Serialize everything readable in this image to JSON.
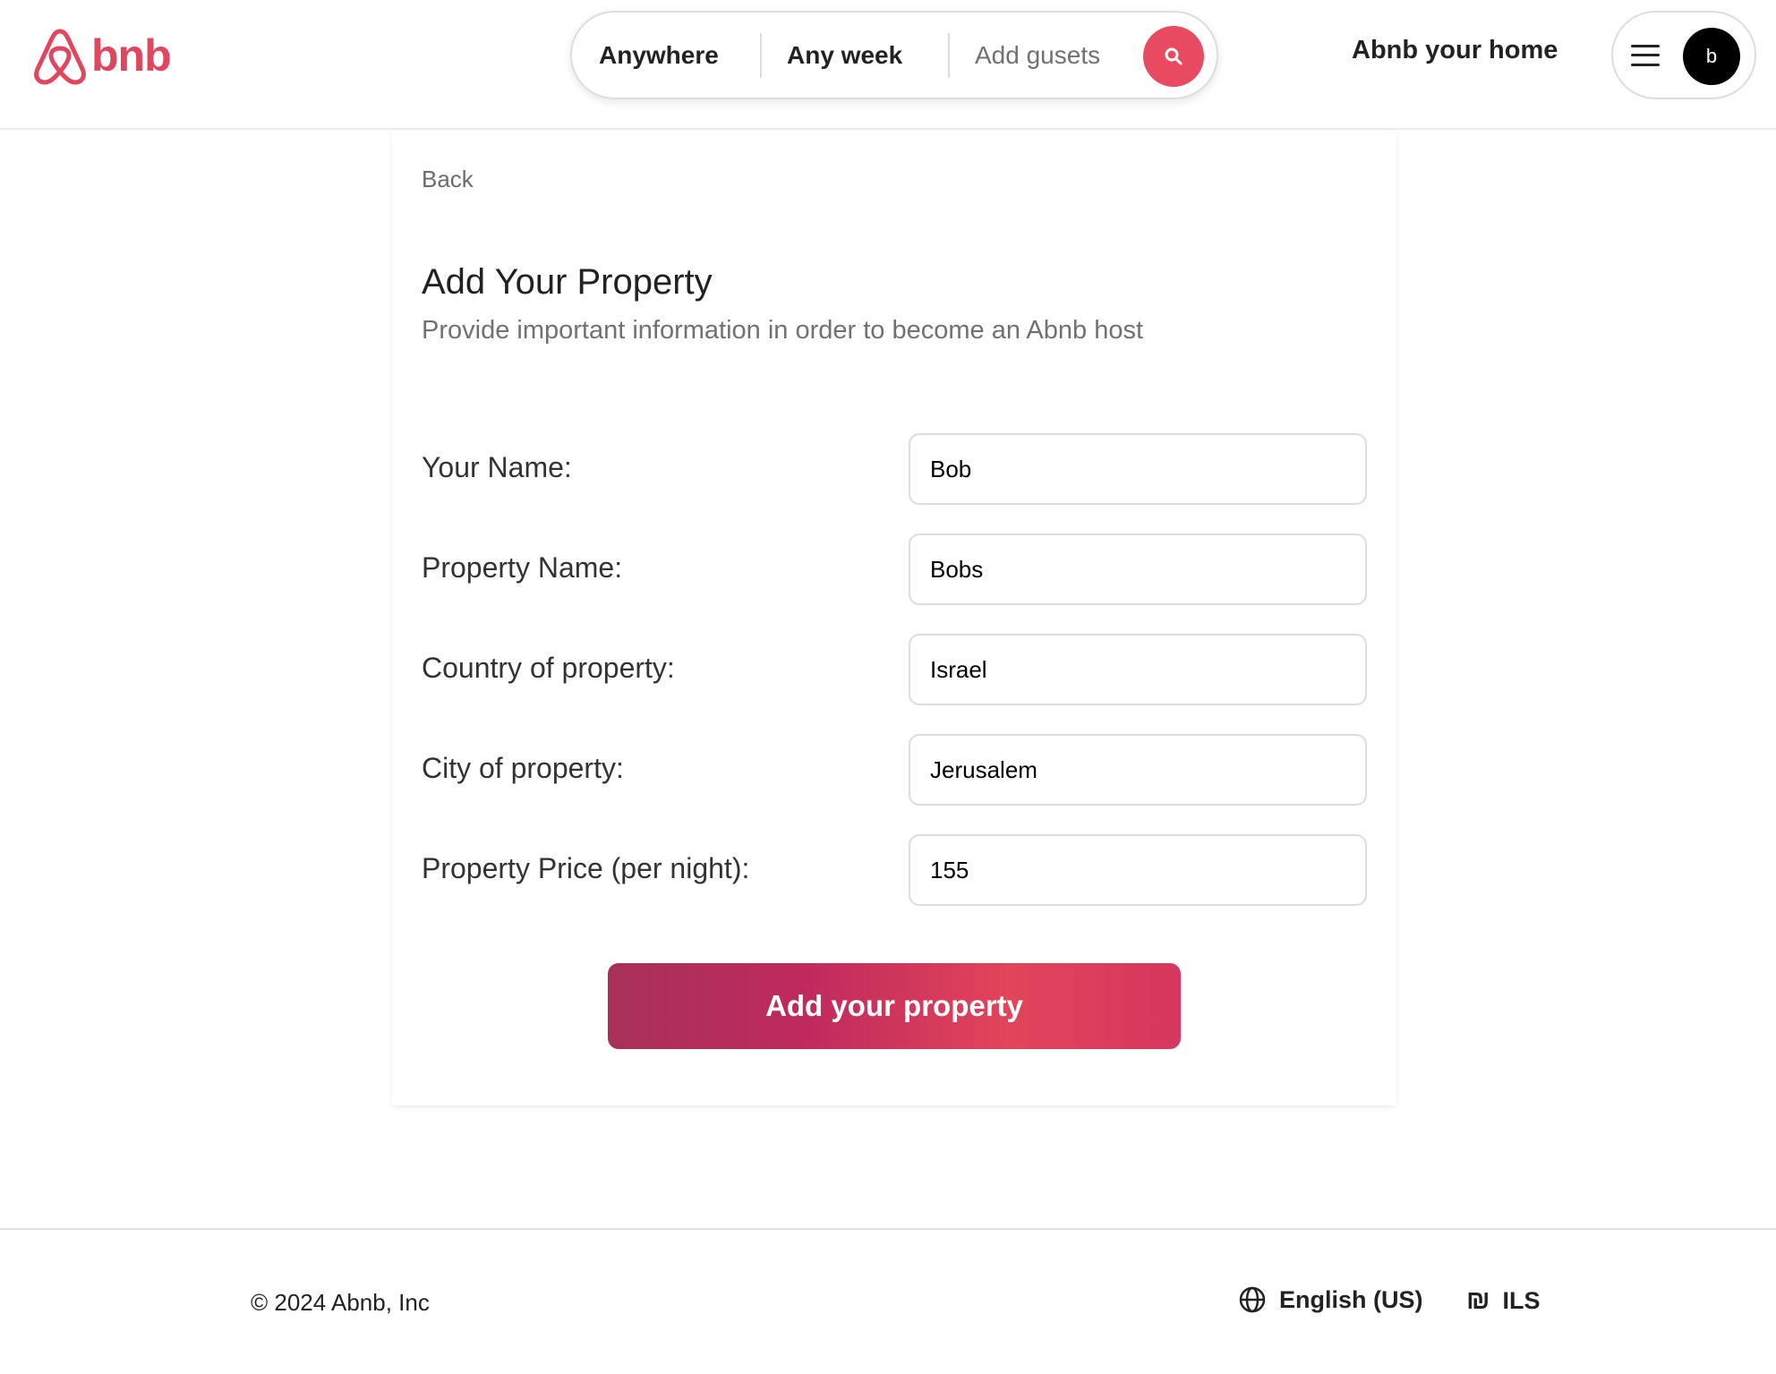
{
  "header": {
    "logo_text": "bnb",
    "search": {
      "anywhere": "Anywhere",
      "any_week": "Any week",
      "guests": "Add gusets"
    },
    "host_link": "Abnb your home",
    "avatar_initial": "b",
    "brand_color": "#E0475F"
  },
  "card": {
    "back": "Back",
    "title": "Add Your Property",
    "subtitle": "Provide important information in order to become an Abnb host",
    "fields": [
      {
        "label": "Your Name:",
        "value": "Bob"
      },
      {
        "label": "Property Name:",
        "value": "Bobs"
      },
      {
        "label": "Country of property:",
        "value": "Israel"
      },
      {
        "label": "City of property:",
        "value": "Jerusalem"
      },
      {
        "label": "Property Price (per night):",
        "value": "155"
      }
    ],
    "submit_label": "Add your property"
  },
  "footer": {
    "copyright": "© 2024 Abnb, Inc",
    "language": "English (US)",
    "currency_symbol": "₪",
    "currency": "ILS"
  }
}
